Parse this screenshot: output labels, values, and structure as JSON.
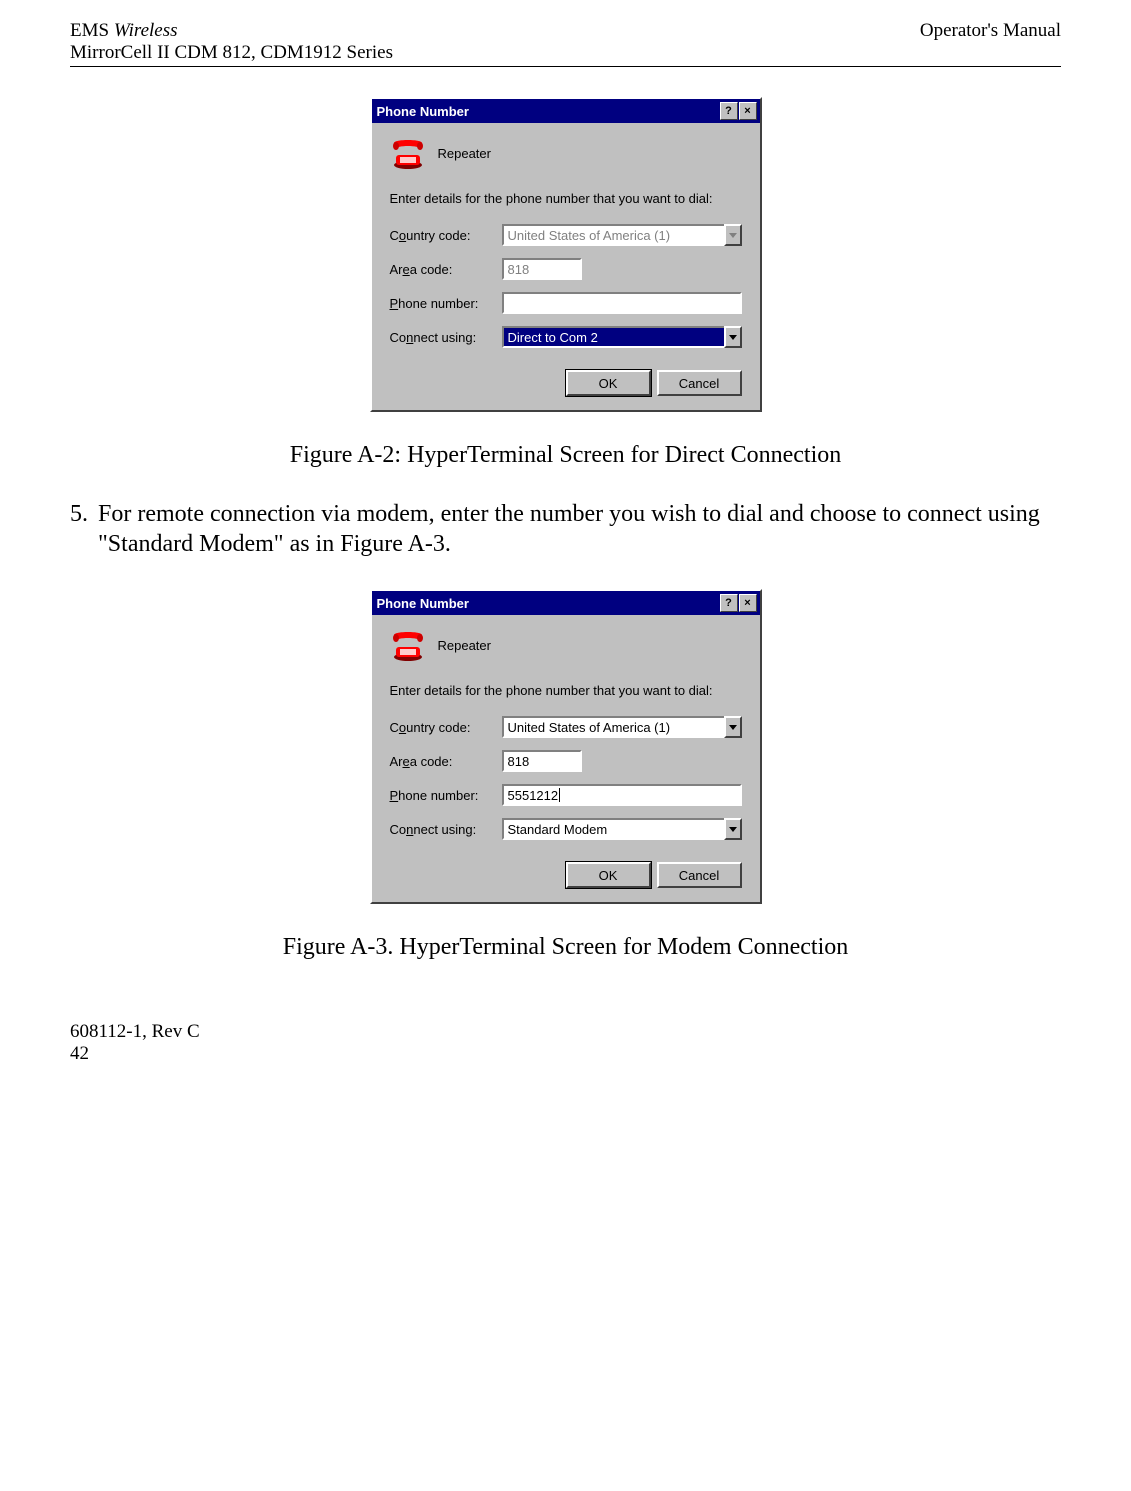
{
  "header": {
    "left_line1_italic": "Wireless",
    "left_line1_prefix": "EMS ",
    "left_line2": "MirrorCell II CDM 812, CDM1912 Series",
    "right": "Operator's Manual"
  },
  "dialog1": {
    "title": "Phone Number",
    "help_btn": "?",
    "close_btn": "×",
    "icon_label": "Repeater",
    "instruction": "Enter details for the phone number that you want to dial:",
    "country_label_pre": "C",
    "country_label_u": "o",
    "country_label_post": "untry code:",
    "country_value": "United States of America (1)",
    "area_label_pre": "Ar",
    "area_label_u": "e",
    "area_label_post": "a code:",
    "area_value": "818",
    "phone_label_u": "P",
    "phone_label_post": "hone number:",
    "phone_value": "",
    "connect_label_pre": "Co",
    "connect_label_u": "n",
    "connect_label_post": "nect using:",
    "connect_value": "Direct to Com 2",
    "ok": "OK",
    "cancel": "Cancel"
  },
  "figure1_caption": "Figure A-2:  HyperTerminal Screen for Direct Connection",
  "body_text": "For remote connection via modem, enter the number you wish to dial and choose to connect using \"Standard Modem\" as in Figure A-3.",
  "list_number": "5.",
  "dialog2": {
    "title": "Phone Number",
    "help_btn": "?",
    "close_btn": "×",
    "icon_label": "Repeater",
    "instruction": "Enter details for the phone number that you want to dial:",
    "country_label_pre": "C",
    "country_label_u": "o",
    "country_label_post": "untry code:",
    "country_value": "United States of America (1)",
    "area_label_pre": "Ar",
    "area_label_u": "e",
    "area_label_post": "a code:",
    "area_value": "818",
    "phone_label_u": "P",
    "phone_label_post": "hone number:",
    "phone_value": "5551212",
    "connect_label_pre": "Co",
    "connect_label_u": "n",
    "connect_label_post": "nect using:",
    "connect_value": "Standard Modem",
    "ok": "OK",
    "cancel": "Cancel"
  },
  "figure2_caption": "Figure A-3. HyperTerminal Screen for Modem Connection",
  "footer": {
    "line1": "608112-1, Rev C",
    "line2": "42"
  }
}
